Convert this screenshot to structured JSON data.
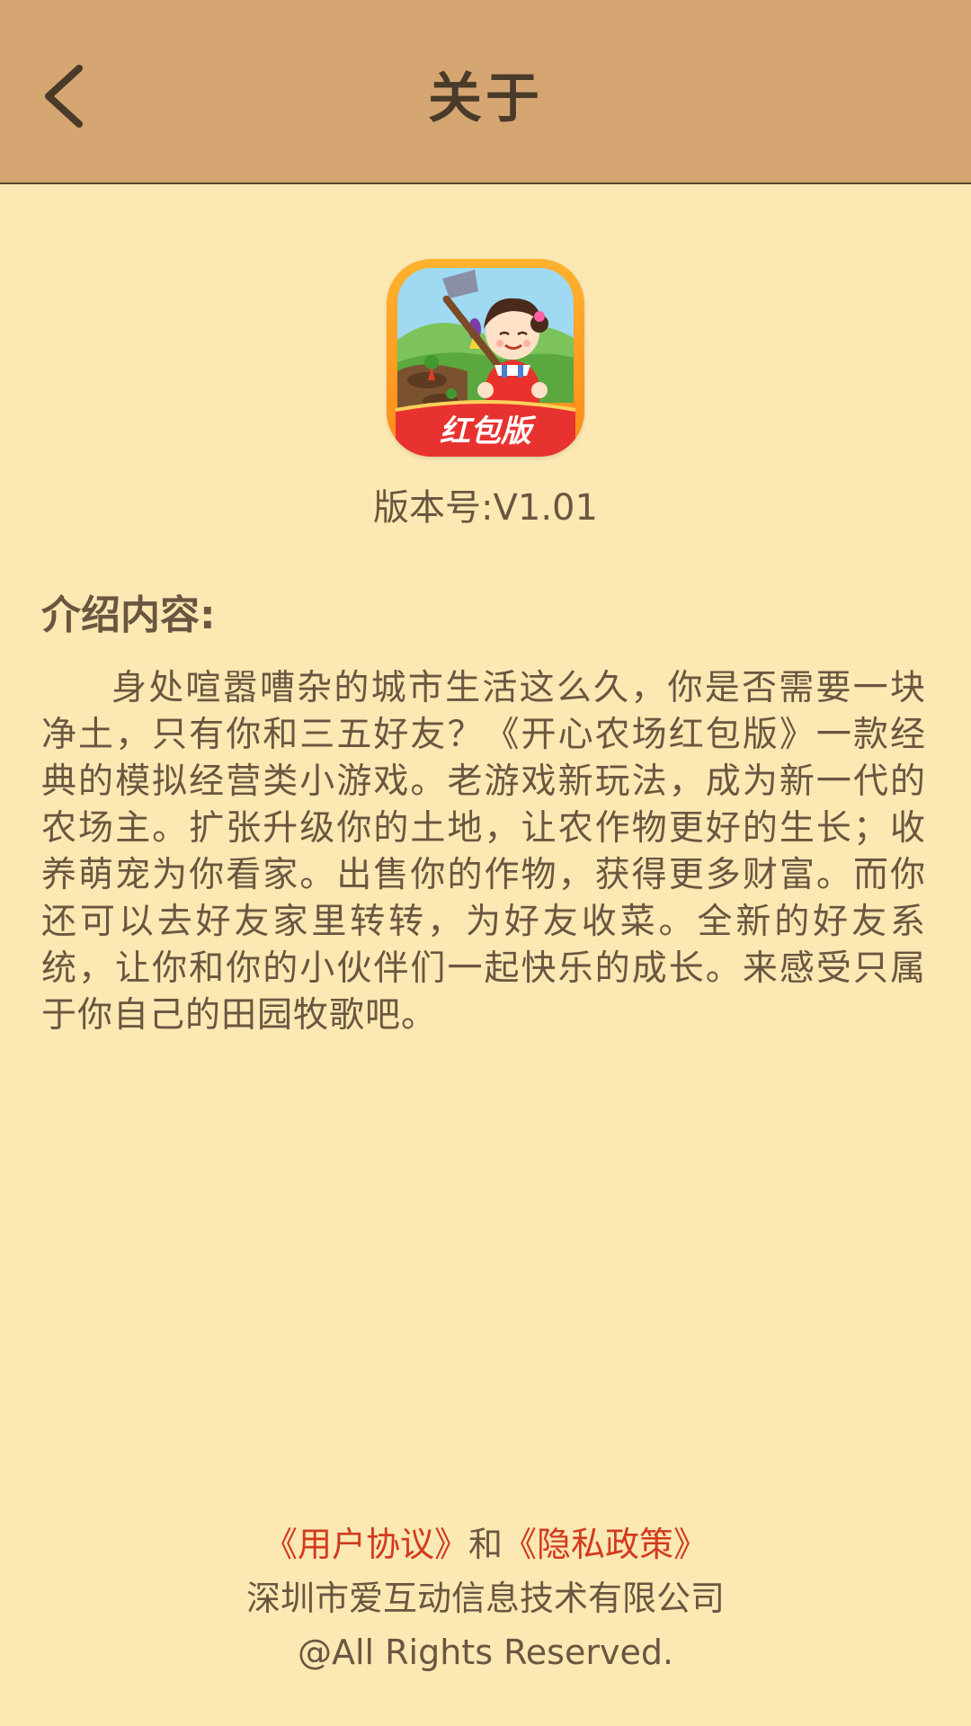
{
  "header": {
    "title": "关于",
    "back_icon": "chevron-left-icon"
  },
  "app": {
    "icon_name": "farm-game-app-icon",
    "icon_badge_text": "红包版",
    "version_text": "版本号:V1.01"
  },
  "intro": {
    "label": "介绍内容:",
    "body": "身处喧嚣嘈杂的城市生活这么久，你是否需要一块净土，只有你和三五好友？《开心农场红包版》一款经典的模拟经营类小游戏。老游戏新玩法，成为新一代的农场主。扩张升级你的土地，让农作物更好的生长；收养萌宠为你看家。出售你的作物，获得更多财富。而你还可以去好友家里转转，为好友收菜。全新的好友系统，让你和你的小伙伴们一起快乐的成长。来感受只属于你自己的田园牧歌吧。"
  },
  "footer": {
    "user_agreement": "《用户协议》",
    "conjunction": "和",
    "privacy_policy": "《隐私政策》",
    "company": "深圳市爱互动信息技术有限公司",
    "copyright": "@All Rights Reserved."
  },
  "colors": {
    "background": "#fbe8b3",
    "header": "#d5a672",
    "link": "#d23a1e",
    "text": "#6a5640"
  }
}
